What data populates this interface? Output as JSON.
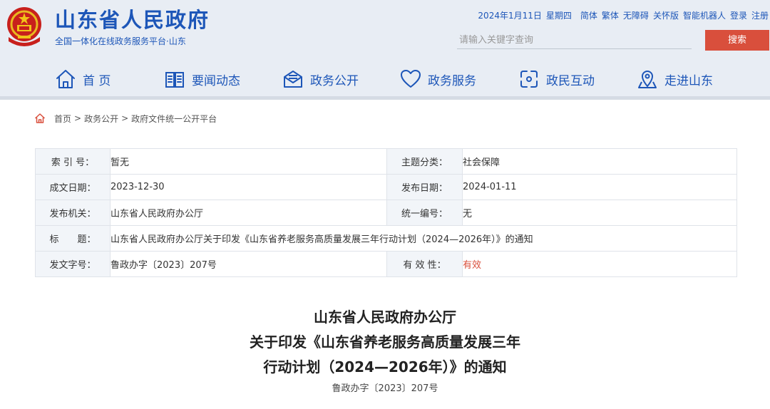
{
  "header": {
    "site_title": "山东省人民政府",
    "site_subtitle": "全国一体化在线政务服务平台·山东",
    "date": "2024年1月11日",
    "weekday": "星期四",
    "links": [
      "简体",
      "繁体",
      "无障碍",
      "关怀版",
      "智能机器人",
      "登录",
      "注册"
    ],
    "search_placeholder": "请输入关键字查询",
    "search_button": "搜索",
    "brand_color": "#1d56b8",
    "accent_color": "#d94f3c"
  },
  "nav": [
    {
      "label": "首 页",
      "icon": "home-icon"
    },
    {
      "label": "要闻动态",
      "icon": "newspaper-icon"
    },
    {
      "label": "政务公开",
      "icon": "mail-icon"
    },
    {
      "label": "政务服务",
      "icon": "heart-icon"
    },
    {
      "label": "政民互动",
      "icon": "interaction-icon"
    },
    {
      "label": "走进山东",
      "icon": "location-icon"
    }
  ],
  "breadcrumb": {
    "icon": "home-icon",
    "items": [
      "首页",
      "政务公开",
      "政府文件统一公开平台"
    ],
    "separator": ">"
  },
  "meta": {
    "index_label": "索 引 号：",
    "index_value": "暂无",
    "category_label": "主题分类：",
    "category_value": "社会保障",
    "written_label": "成文日期：",
    "written_value": "2023-12-30",
    "published_label": "发布日期：",
    "published_value": "2024-01-11",
    "issuer_label": "发布机关：",
    "issuer_value": "山东省人民政府办公厅",
    "serial_label": "统一编号：",
    "serial_value": "无",
    "title_label": "标　　题：",
    "title_value": "山东省人民政府办公厅关于印发《山东省养老服务高质量发展三年行动计划（2024—2026年）》的通知",
    "docno_label": "发文字号：",
    "docno_value": "鲁政办字〔2023〕207号",
    "validity_label": "有 效 性：",
    "validity_value": "有效"
  },
  "document": {
    "title_lines": [
      "山东省人民政府办公厅",
      "关于印发《山东省养老服务高质量发展三年",
      "行动计划（2024—2026年）》的通知"
    ],
    "number": "鲁政办字〔2023〕207号"
  }
}
